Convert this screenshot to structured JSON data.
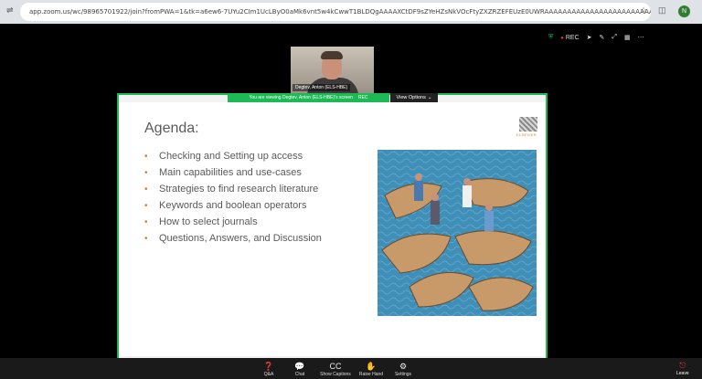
{
  "browser": {
    "url": "app.zoom.us/wc/98965701922/join?fromPWA=1&tk=a6ew6-7UYu2CIm1UcLByO0aMk6vnt5w4kCwwT1BLDQgAAAAXCtDF9sZYeHZsNkVOcFtyZXZRZEFEUzE0UWRAAAAAAAAAAAAAAAAAAAAAAAAAAAAAAAAAAAAAAAAAA&pwd=sXprBLjGARcCnsWgYnKM...",
    "profile_initial": "N"
  },
  "status": {
    "rec_label": "REC"
  },
  "video": {
    "participant_name": "Degtev, Anton (ELS-HBE)"
  },
  "share": {
    "banner_text": "You are viewing  Degtev, Anton (ELS-HBE)'s screen",
    "banner_rec": "REC",
    "view_options_label": "View Options"
  },
  "slide": {
    "title": "Agenda:",
    "items": [
      "Checking and Setting up access",
      "Main capabilities and use-cases",
      "Strategies to find research literature",
      "Keywords and boolean operators",
      "How to select journals",
      "Questions, Answers, and Discussion"
    ],
    "logo_text": "ELSEVIER"
  },
  "controls": [
    {
      "icon": "qa-icon",
      "glyph": "❓",
      "label": "Q&A"
    },
    {
      "icon": "chat-icon",
      "glyph": "💬",
      "label": "Chat"
    },
    {
      "icon": "captions-icon",
      "glyph": "CC",
      "label": "Show Captions"
    },
    {
      "icon": "raise-hand-icon",
      "glyph": "✋",
      "label": "Raise Hand"
    },
    {
      "icon": "settings-icon",
      "glyph": "⚙",
      "label": "Settings"
    }
  ],
  "leave_label": "Leave",
  "colors": {
    "accent_green": "#1db954",
    "bullet_orange": "#e07a2e",
    "water_blue": "#3f8fb8"
  }
}
